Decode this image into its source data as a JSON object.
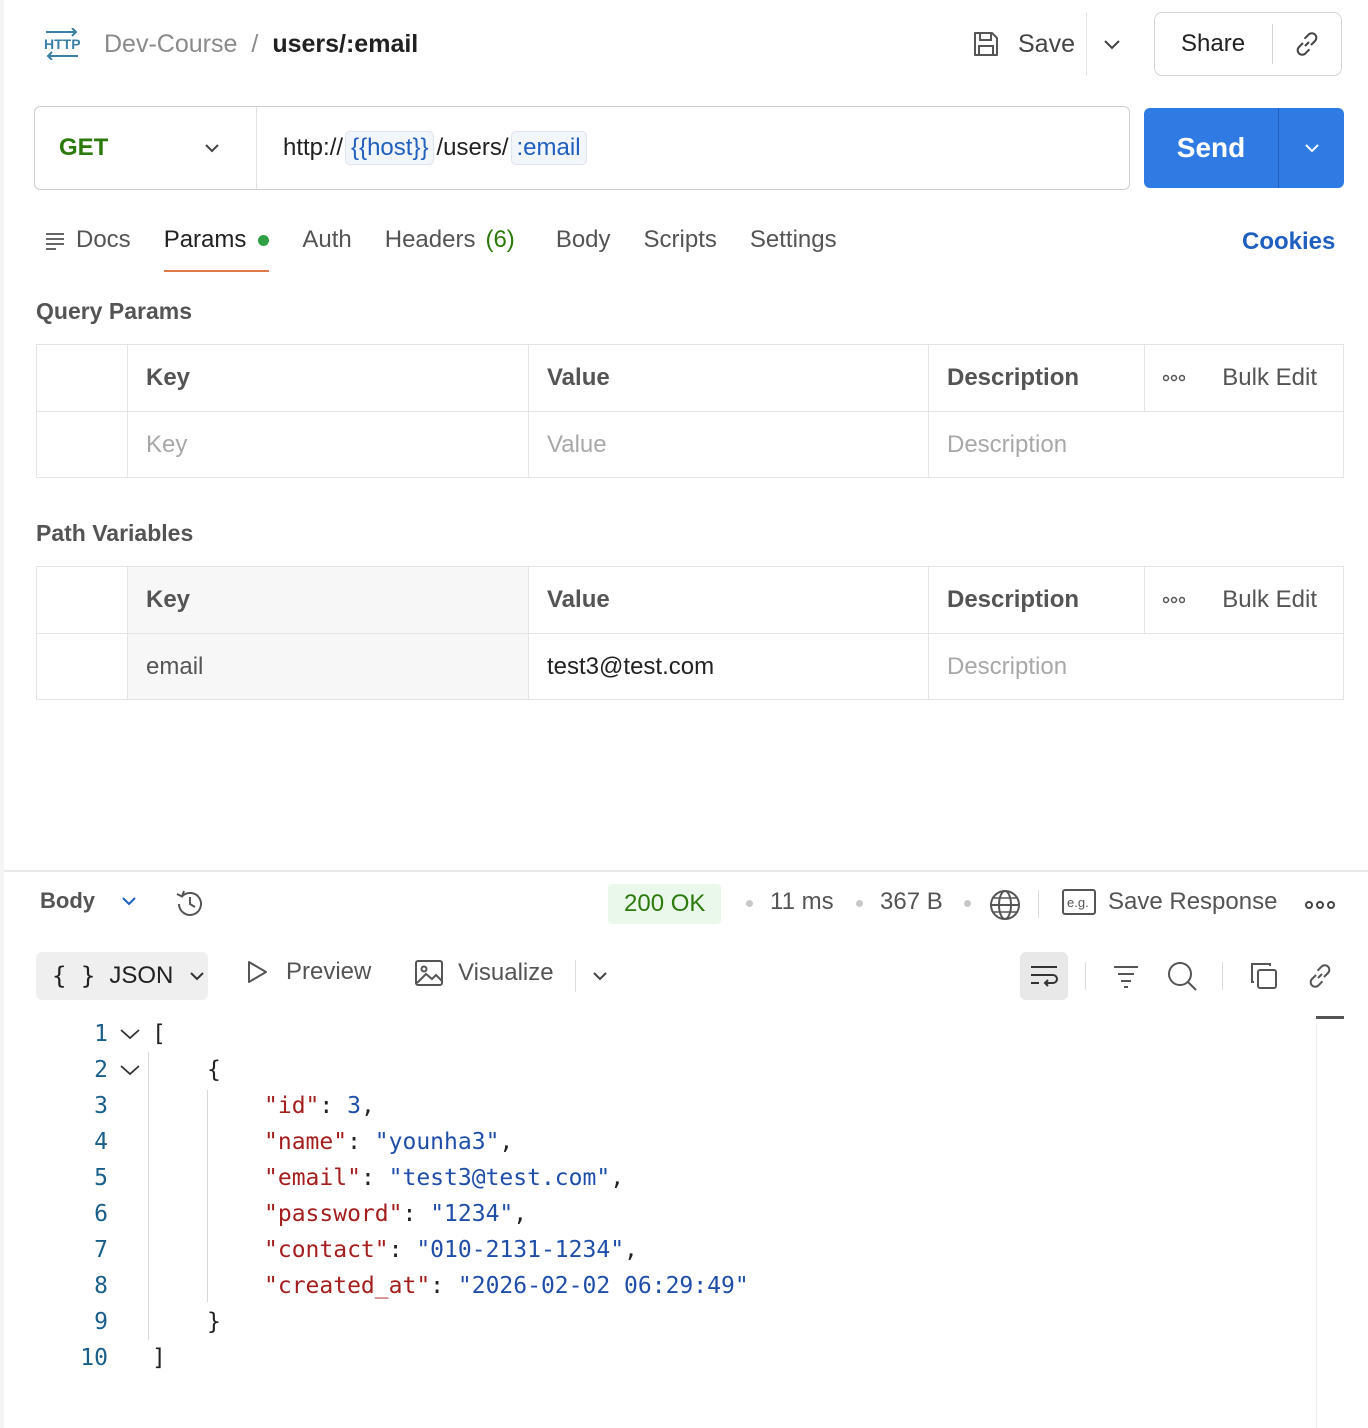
{
  "header": {
    "request_type_icon": "http-icon",
    "collection": "Dev-Course",
    "separator": "/",
    "request_name": "users/:email",
    "save_label": "Save",
    "share_label": "Share"
  },
  "request": {
    "method": "GET",
    "url_prefix": "http://",
    "url_host_var": "{{host}}",
    "url_path": "/users/",
    "url_path_var": ":email",
    "send_label": "Send"
  },
  "tabs": [
    {
      "label": "Docs"
    },
    {
      "label": "Params",
      "active": true,
      "indicator": "green-dot"
    },
    {
      "label": "Auth"
    },
    {
      "label": "Headers",
      "count": "(6)"
    },
    {
      "label": "Body"
    },
    {
      "label": "Scripts"
    },
    {
      "label": "Settings"
    }
  ],
  "cookies_label": "Cookies",
  "query_params": {
    "title": "Query Params",
    "headers": {
      "key": "Key",
      "value": "Value",
      "description": "Description",
      "bulk_edit": "Bulk Edit"
    },
    "placeholders": {
      "key": "Key",
      "value": "Value",
      "description": "Description"
    }
  },
  "path_variables": {
    "title": "Path Variables",
    "headers": {
      "key": "Key",
      "value": "Value",
      "description": "Description",
      "bulk_edit": "Bulk Edit"
    },
    "rows": [
      {
        "key": "email",
        "value": "test3@test.com",
        "description_placeholder": "Description"
      }
    ]
  },
  "response": {
    "section_label": "Body",
    "status": "200 OK",
    "time": "11 ms",
    "size": "367 B",
    "save_response_label": "Save Response",
    "format": "JSON",
    "format_braces": "{ }",
    "preview_label": "Preview",
    "visualize_label": "Visualize",
    "status_color": "#2b7a0b",
    "code_lines": [
      {
        "n": "1",
        "text": "["
      },
      {
        "n": "2",
        "text": "{"
      },
      {
        "n": "3",
        "key": "\"id\"",
        "val": "3",
        "trail": ","
      },
      {
        "n": "4",
        "key": "\"name\"",
        "val": "\"younha3\"",
        "trail": ","
      },
      {
        "n": "5",
        "key": "\"email\"",
        "val": "\"test3@test.com\"",
        "trail": ","
      },
      {
        "n": "6",
        "key": "\"password\"",
        "val": "\"1234\"",
        "trail": ","
      },
      {
        "n": "7",
        "key": "\"contact\"",
        "val": "\"010-2131-1234\"",
        "trail": ","
      },
      {
        "n": "8",
        "key": "\"created_at\"",
        "val": "\"2026-02-02 06:29:49\"",
        "trail": ""
      },
      {
        "n": "9",
        "text": "}"
      },
      {
        "n": "10",
        "text": "]"
      }
    ]
  },
  "colors": {
    "accent": "#2f7be3",
    "method_get": "#2b7a0b",
    "active_tab_underline": "#e0794a",
    "link": "#1f5fbf"
  }
}
